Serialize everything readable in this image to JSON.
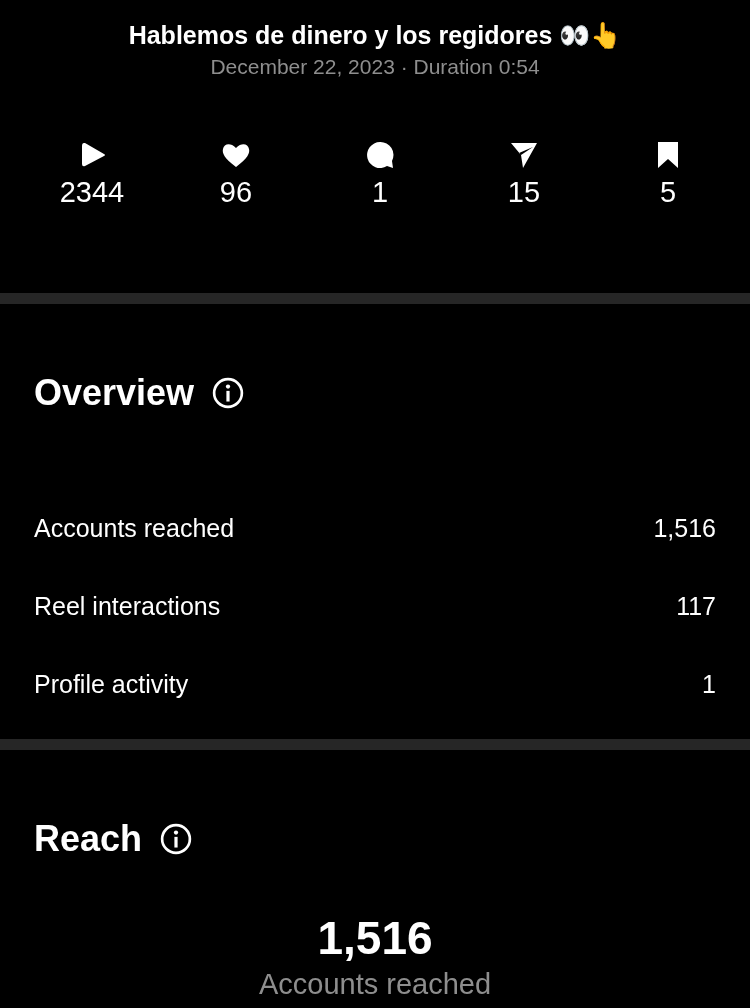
{
  "header": {
    "title": "Hablemos de dinero y los regidores 👀👆",
    "subtitle": "December 22, 2023 · Duration 0:54"
  },
  "stats": [
    {
      "kind": "plays",
      "value": "2344"
    },
    {
      "kind": "likes",
      "value": "96"
    },
    {
      "kind": "comments",
      "value": "1"
    },
    {
      "kind": "shares",
      "value": "15"
    },
    {
      "kind": "saves",
      "value": "5"
    }
  ],
  "overview": {
    "title": "Overview",
    "rows": [
      {
        "label": "Accounts reached",
        "value": "1,516"
      },
      {
        "label": "Reel interactions",
        "value": "117"
      },
      {
        "label": "Profile activity",
        "value": "1"
      }
    ]
  },
  "reach": {
    "title": "Reach",
    "value": "1,516",
    "caption": "Accounts reached"
  }
}
